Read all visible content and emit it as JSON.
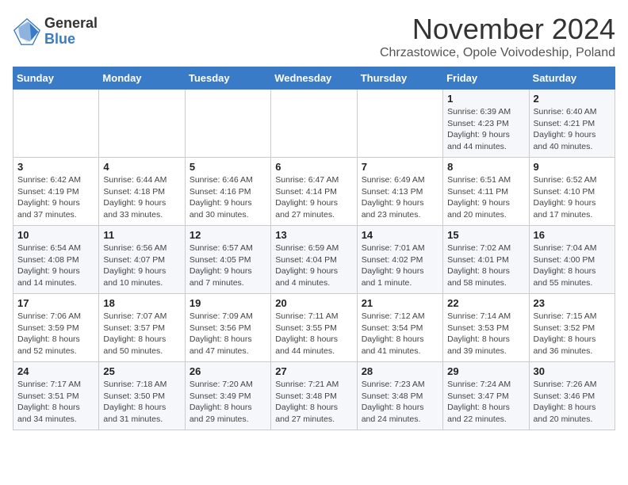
{
  "logo": {
    "general": "General",
    "blue": "Blue"
  },
  "title": "November 2024",
  "subtitle": "Chrzastowice, Opole Voivodeship, Poland",
  "days_of_week": [
    "Sunday",
    "Monday",
    "Tuesday",
    "Wednesday",
    "Thursday",
    "Friday",
    "Saturday"
  ],
  "weeks": [
    [
      {
        "day": "",
        "info": ""
      },
      {
        "day": "",
        "info": ""
      },
      {
        "day": "",
        "info": ""
      },
      {
        "day": "",
        "info": ""
      },
      {
        "day": "",
        "info": ""
      },
      {
        "day": "1",
        "info": "Sunrise: 6:39 AM\nSunset: 4:23 PM\nDaylight: 9 hours\nand 44 minutes."
      },
      {
        "day": "2",
        "info": "Sunrise: 6:40 AM\nSunset: 4:21 PM\nDaylight: 9 hours\nand 40 minutes."
      }
    ],
    [
      {
        "day": "3",
        "info": "Sunrise: 6:42 AM\nSunset: 4:19 PM\nDaylight: 9 hours\nand 37 minutes."
      },
      {
        "day": "4",
        "info": "Sunrise: 6:44 AM\nSunset: 4:18 PM\nDaylight: 9 hours\nand 33 minutes."
      },
      {
        "day": "5",
        "info": "Sunrise: 6:46 AM\nSunset: 4:16 PM\nDaylight: 9 hours\nand 30 minutes."
      },
      {
        "day": "6",
        "info": "Sunrise: 6:47 AM\nSunset: 4:14 PM\nDaylight: 9 hours\nand 27 minutes."
      },
      {
        "day": "7",
        "info": "Sunrise: 6:49 AM\nSunset: 4:13 PM\nDaylight: 9 hours\nand 23 minutes."
      },
      {
        "day": "8",
        "info": "Sunrise: 6:51 AM\nSunset: 4:11 PM\nDaylight: 9 hours\nand 20 minutes."
      },
      {
        "day": "9",
        "info": "Sunrise: 6:52 AM\nSunset: 4:10 PM\nDaylight: 9 hours\nand 17 minutes."
      }
    ],
    [
      {
        "day": "10",
        "info": "Sunrise: 6:54 AM\nSunset: 4:08 PM\nDaylight: 9 hours\nand 14 minutes."
      },
      {
        "day": "11",
        "info": "Sunrise: 6:56 AM\nSunset: 4:07 PM\nDaylight: 9 hours\nand 10 minutes."
      },
      {
        "day": "12",
        "info": "Sunrise: 6:57 AM\nSunset: 4:05 PM\nDaylight: 9 hours\nand 7 minutes."
      },
      {
        "day": "13",
        "info": "Sunrise: 6:59 AM\nSunset: 4:04 PM\nDaylight: 9 hours\nand 4 minutes."
      },
      {
        "day": "14",
        "info": "Sunrise: 7:01 AM\nSunset: 4:02 PM\nDaylight: 9 hours\nand 1 minute."
      },
      {
        "day": "15",
        "info": "Sunrise: 7:02 AM\nSunset: 4:01 PM\nDaylight: 8 hours\nand 58 minutes."
      },
      {
        "day": "16",
        "info": "Sunrise: 7:04 AM\nSunset: 4:00 PM\nDaylight: 8 hours\nand 55 minutes."
      }
    ],
    [
      {
        "day": "17",
        "info": "Sunrise: 7:06 AM\nSunset: 3:59 PM\nDaylight: 8 hours\nand 52 minutes."
      },
      {
        "day": "18",
        "info": "Sunrise: 7:07 AM\nSunset: 3:57 PM\nDaylight: 8 hours\nand 50 minutes."
      },
      {
        "day": "19",
        "info": "Sunrise: 7:09 AM\nSunset: 3:56 PM\nDaylight: 8 hours\nand 47 minutes."
      },
      {
        "day": "20",
        "info": "Sunrise: 7:11 AM\nSunset: 3:55 PM\nDaylight: 8 hours\nand 44 minutes."
      },
      {
        "day": "21",
        "info": "Sunrise: 7:12 AM\nSunset: 3:54 PM\nDaylight: 8 hours\nand 41 minutes."
      },
      {
        "day": "22",
        "info": "Sunrise: 7:14 AM\nSunset: 3:53 PM\nDaylight: 8 hours\nand 39 minutes."
      },
      {
        "day": "23",
        "info": "Sunrise: 7:15 AM\nSunset: 3:52 PM\nDaylight: 8 hours\nand 36 minutes."
      }
    ],
    [
      {
        "day": "24",
        "info": "Sunrise: 7:17 AM\nSunset: 3:51 PM\nDaylight: 8 hours\nand 34 minutes."
      },
      {
        "day": "25",
        "info": "Sunrise: 7:18 AM\nSunset: 3:50 PM\nDaylight: 8 hours\nand 31 minutes."
      },
      {
        "day": "26",
        "info": "Sunrise: 7:20 AM\nSunset: 3:49 PM\nDaylight: 8 hours\nand 29 minutes."
      },
      {
        "day": "27",
        "info": "Sunrise: 7:21 AM\nSunset: 3:48 PM\nDaylight: 8 hours\nand 27 minutes."
      },
      {
        "day": "28",
        "info": "Sunrise: 7:23 AM\nSunset: 3:48 PM\nDaylight: 8 hours\nand 24 minutes."
      },
      {
        "day": "29",
        "info": "Sunrise: 7:24 AM\nSunset: 3:47 PM\nDaylight: 8 hours\nand 22 minutes."
      },
      {
        "day": "30",
        "info": "Sunrise: 7:26 AM\nSunset: 3:46 PM\nDaylight: 8 hours\nand 20 minutes."
      }
    ]
  ]
}
